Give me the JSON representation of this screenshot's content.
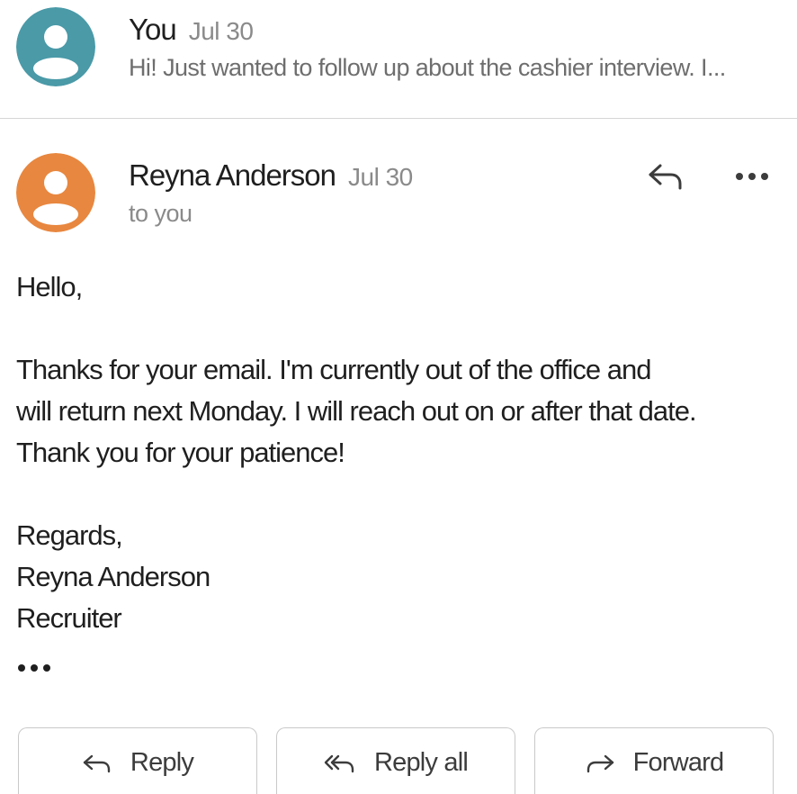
{
  "thread": {
    "collapsed_message": {
      "sender": "You",
      "date": "Jul 30",
      "snippet": "Hi! Just wanted to follow up about the cashier interview. I...",
      "avatar_color": "#4a9aa8"
    },
    "expanded_message": {
      "sender": "Reyna Anderson",
      "date": "Jul 30",
      "recipient_line": "to you",
      "avatar_color": "#e8873f",
      "header_icons": [
        "reply-icon",
        "more-horizontal-icon"
      ],
      "body": {
        "greeting": "Hello,",
        "paragraph_lines": [
          "Thanks for your email. I'm currently out of the office and",
          "will return next Monday. I will reach out on or after that date.",
          "Thank you for your patience!"
        ],
        "closing": "Regards,",
        "signature_name": "Reyna Anderson",
        "signature_title": "Recruiter"
      },
      "show_trimmed_icon": "more-horizontal-icon"
    }
  },
  "actions": {
    "reply_label": "Reply",
    "reply_all_label": "Reply all",
    "forward_label": "Forward"
  },
  "colors": {
    "divider": "#d6d6d6",
    "secondary_text": "#8a8a8a",
    "primary_text": "#1f1f1f"
  }
}
